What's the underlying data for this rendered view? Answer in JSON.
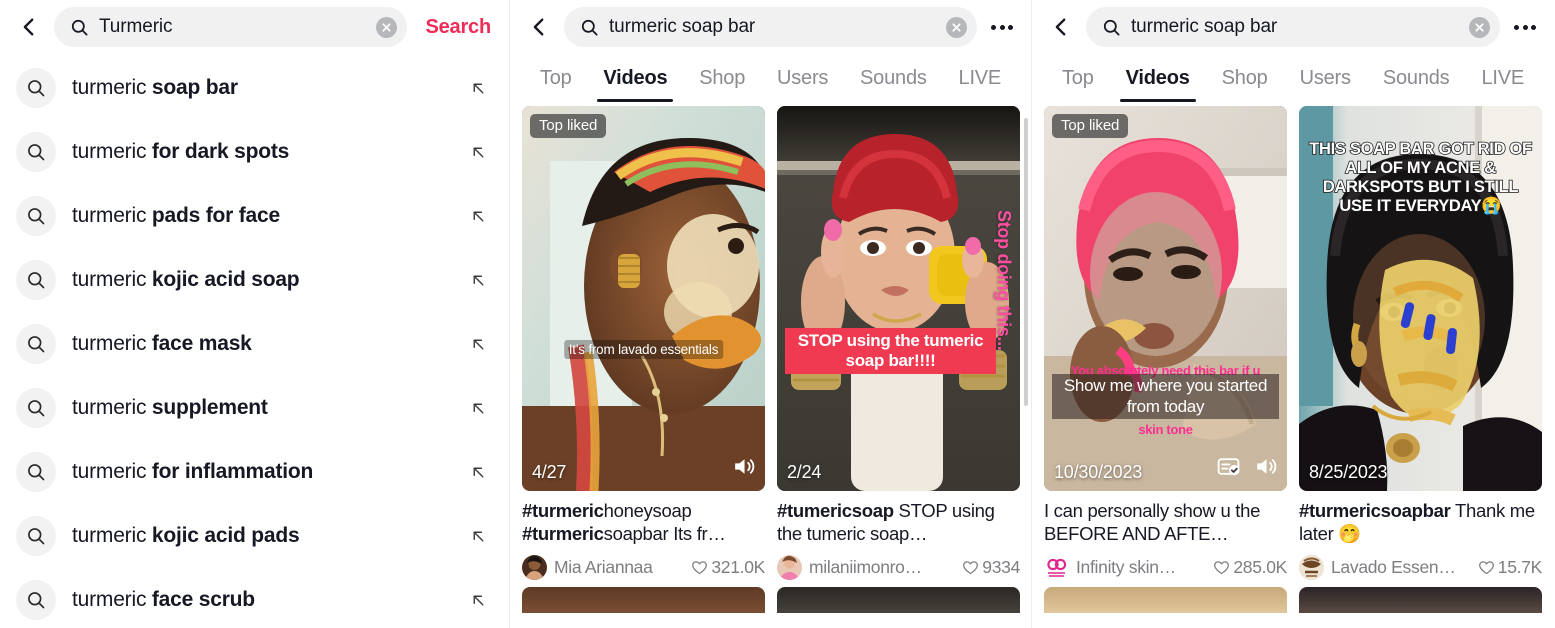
{
  "panels": {
    "suggest": {
      "search": {
        "value": "Turmeric",
        "placeholder": "Search",
        "action_label": "Search",
        "back_icon": "chevron-left-icon",
        "magnifier_icon": "search-icon",
        "clear_icon": "clear-circle-icon"
      },
      "suggestions": [
        {
          "prefix": "turmeric ",
          "match": "soap bar"
        },
        {
          "prefix": "turmeric ",
          "match": "for dark spots"
        },
        {
          "prefix": "turmeric ",
          "match": "pads for face"
        },
        {
          "prefix": "turmeric ",
          "match": "kojic acid soap"
        },
        {
          "prefix": "turmeric ",
          "match": "face mask"
        },
        {
          "prefix": "turmeric ",
          "match": "supplement"
        },
        {
          "prefix": "turmeric ",
          "match": "for inflammation"
        },
        {
          "prefix": "turmeric ",
          "match": "kojic acid pads"
        },
        {
          "prefix": "turmeric ",
          "match": "face scrub"
        }
      ],
      "row_arrow_icon": "arrow-up-left-icon",
      "row_search_icon": "search-icon"
    },
    "results_mid": {
      "search": {
        "value": "turmeric soap bar",
        "back_icon": "chevron-left-icon",
        "magnifier_icon": "search-icon",
        "clear_icon": "clear-circle-icon",
        "more_icon": "more-dots-icon"
      },
      "tabs": [
        {
          "label": "Top",
          "active": false
        },
        {
          "label": "Videos",
          "active": true
        },
        {
          "label": "Shop",
          "active": false
        },
        {
          "label": "Users",
          "active": false
        },
        {
          "label": "Sounds",
          "active": false
        },
        {
          "label": "LIVE",
          "active": false
        }
      ],
      "videos": [
        {
          "badge": "Top liked",
          "date": "4/27",
          "overlay_caption": "It's from lavado essentials",
          "caption_bold": "#turmeric",
          "caption_rest": "honeysoap ",
          "caption_bold2": "#turmeric",
          "caption_rest2": "soapbar Its fr…",
          "username": "Mia Ariannaa",
          "likes": "321.0K",
          "sound_icon": "speaker-icon",
          "like_icon": "heart-icon"
        },
        {
          "badge": "",
          "date": "2/24",
          "overlay_red": "STOP using the tumeric soap bar!!!!",
          "overlay_vertical": "Stop doing this...",
          "caption_bold": "#tumericsoap",
          "caption_rest": " STOP using the tumeric soap…",
          "username": "milaniimonro…",
          "likes": "9334",
          "like_icon": "heart-icon"
        }
      ]
    },
    "results_right": {
      "search": {
        "value": "turmeric soap bar",
        "back_icon": "chevron-left-icon",
        "magnifier_icon": "search-icon",
        "clear_icon": "clear-circle-icon",
        "more_icon": "more-dots-icon"
      },
      "tabs": [
        {
          "label": "Top",
          "active": false
        },
        {
          "label": "Videos",
          "active": true
        },
        {
          "label": "Shop",
          "active": false
        },
        {
          "label": "Users",
          "active": false
        },
        {
          "label": "Sounds",
          "active": false
        },
        {
          "label": "LIVE",
          "active": false
        }
      ],
      "videos": [
        {
          "badge": "Top liked",
          "date": "10/30/2023",
          "overlay_pink_top": "You absolutely need this bar if u",
          "overlay_pink_bottom": "skin tone",
          "overlay_caption": "Show me where you started from today",
          "caption_plain": "I can personally show u the BEFORE AND AFTE…",
          "username": "Infinity skin…",
          "likes": "285.0K",
          "cc_icon": "captions-icon",
          "sound_icon": "speaker-icon",
          "like_icon": "heart-icon"
        },
        {
          "badge": "",
          "date": "8/25/2023",
          "overlay_outline": "THIS SOAP BAR GOT RID OF ALL OF MY ACNE & DARKSPOTS BUT I STILL USE IT EVERYDAY😭",
          "caption_bold": "#turmericsoapbar",
          "caption_rest": " Thank me later 🤭",
          "username": "Lavado Essen…",
          "likes": "15.7K",
          "like_icon": "heart-icon"
        }
      ]
    }
  },
  "colors": {
    "accent": "#f02c56",
    "text": "#161823",
    "muted": "#7d7e83",
    "field_bg": "#f1f1f2"
  }
}
